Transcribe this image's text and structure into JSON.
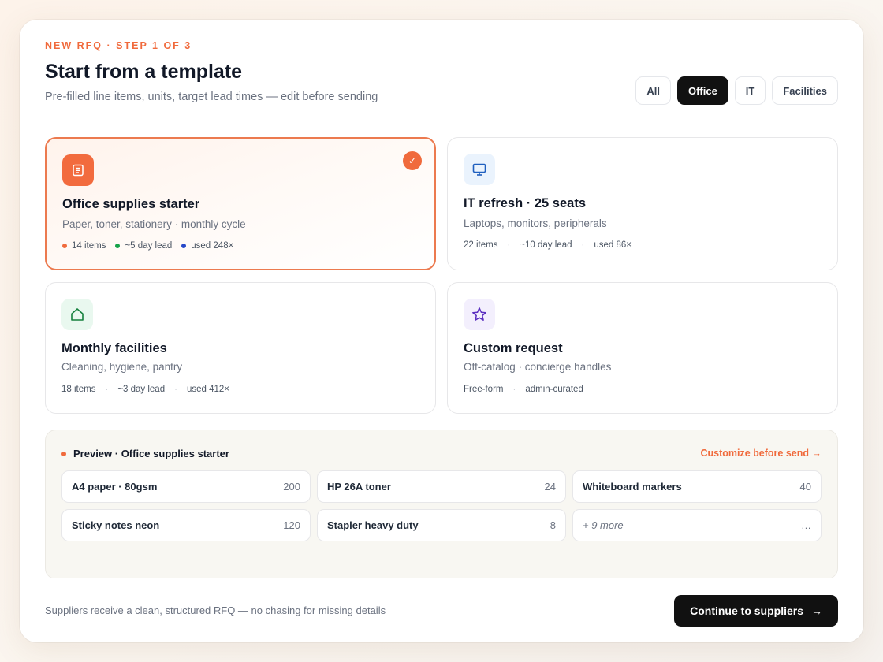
{
  "header": {
    "step_label": "NEW RFQ · STEP 1 OF 3",
    "title": "Start from a template",
    "subtitle": "Pre-filled line items, units, target lead times — edit before sending",
    "filters": [
      "All",
      "Office",
      "IT",
      "Facilities"
    ],
    "active_filter": "Office"
  },
  "templates": [
    {
      "title": "Office supplies starter",
      "subtitle": "Paper, toner, stationery · monthly cycle",
      "items": "14 items",
      "lead": "~5 day lead",
      "used": "used 248×",
      "icon": "document-icon",
      "selected": true
    },
    {
      "title": "IT refresh · 25 seats",
      "subtitle": "Laptops, monitors, peripherals",
      "items": "22 items",
      "lead": "~10 day lead",
      "used": "used 86×",
      "icon": "monitor-icon",
      "selected": false
    },
    {
      "title": "Monthly facilities",
      "subtitle": "Cleaning, hygiene, pantry",
      "items": "18 items",
      "lead": "~3 day lead",
      "used": "used 412×",
      "icon": "home-icon",
      "selected": false
    },
    {
      "title": "Custom request",
      "subtitle": "Off-catalog · concierge handles",
      "items": "Free-form",
      "lead": "admin-curated",
      "icon": "star-icon",
      "selected": false
    }
  ],
  "preview": {
    "title": "Preview · Office supplies starter",
    "customize_label": "Customize before send →",
    "items": [
      {
        "name": "A4 paper · 80gsm",
        "qty": "200"
      },
      {
        "name": "HP 26A toner",
        "qty": "24"
      },
      {
        "name": "Whiteboard markers",
        "qty": "40"
      },
      {
        "name": "Sticky notes neon",
        "qty": "120"
      },
      {
        "name": "Stapler heavy duty",
        "qty": "8"
      },
      {
        "name": "+ 9 more",
        "qty": "…"
      }
    ]
  },
  "footer": {
    "note": "Suppliers receive a clean, structured RFQ — no chasing for missing details",
    "continue_label": "Continue to suppliers",
    "continue_arrow": "→"
  },
  "colors": {
    "accent": "#f06a3c",
    "dot_green": "#16a34a",
    "dot_blue": "#2748c9"
  }
}
